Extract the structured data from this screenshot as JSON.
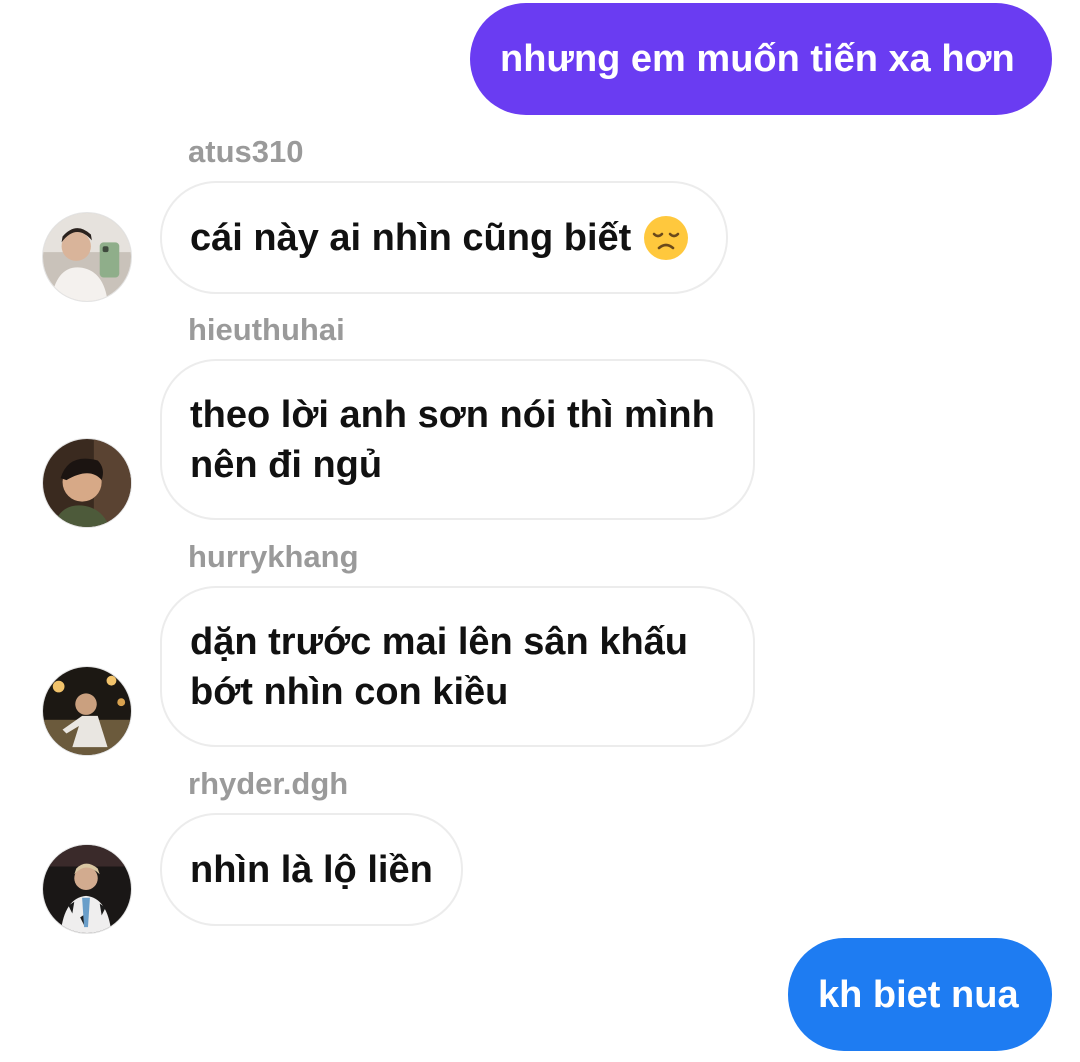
{
  "thread": {
    "messages": [
      {
        "direction": "outgoing",
        "text": "nhưng em muốn tiến xa hơn",
        "color": "#6a3cf2"
      },
      {
        "direction": "incoming",
        "sender": "atus310",
        "text": "cái này ai nhìn cũng biết",
        "emoji": "disappointed-face-emoji"
      },
      {
        "direction": "incoming",
        "sender": "hieuthuhai",
        "text_line1": "theo lời anh sơn nói thì mình",
        "text_line2": "nên đi ngủ"
      },
      {
        "direction": "incoming",
        "sender": "hurrykhang",
        "text_line1": "dặn trước mai lên sân khấu",
        "text_line2": "bớt nhìn con kiều"
      },
      {
        "direction": "incoming",
        "sender": "rhyder.dgh",
        "text": "nhìn là lộ liền"
      },
      {
        "direction": "outgoing",
        "text": "kh biet nua",
        "color": "#1e7cf2"
      }
    ]
  },
  "colors": {
    "outgoing_purple": "#6a3cf2",
    "outgoing_blue": "#1e7cf2",
    "sender_name": "#9a9a9a",
    "incoming_border": "#ececec"
  }
}
